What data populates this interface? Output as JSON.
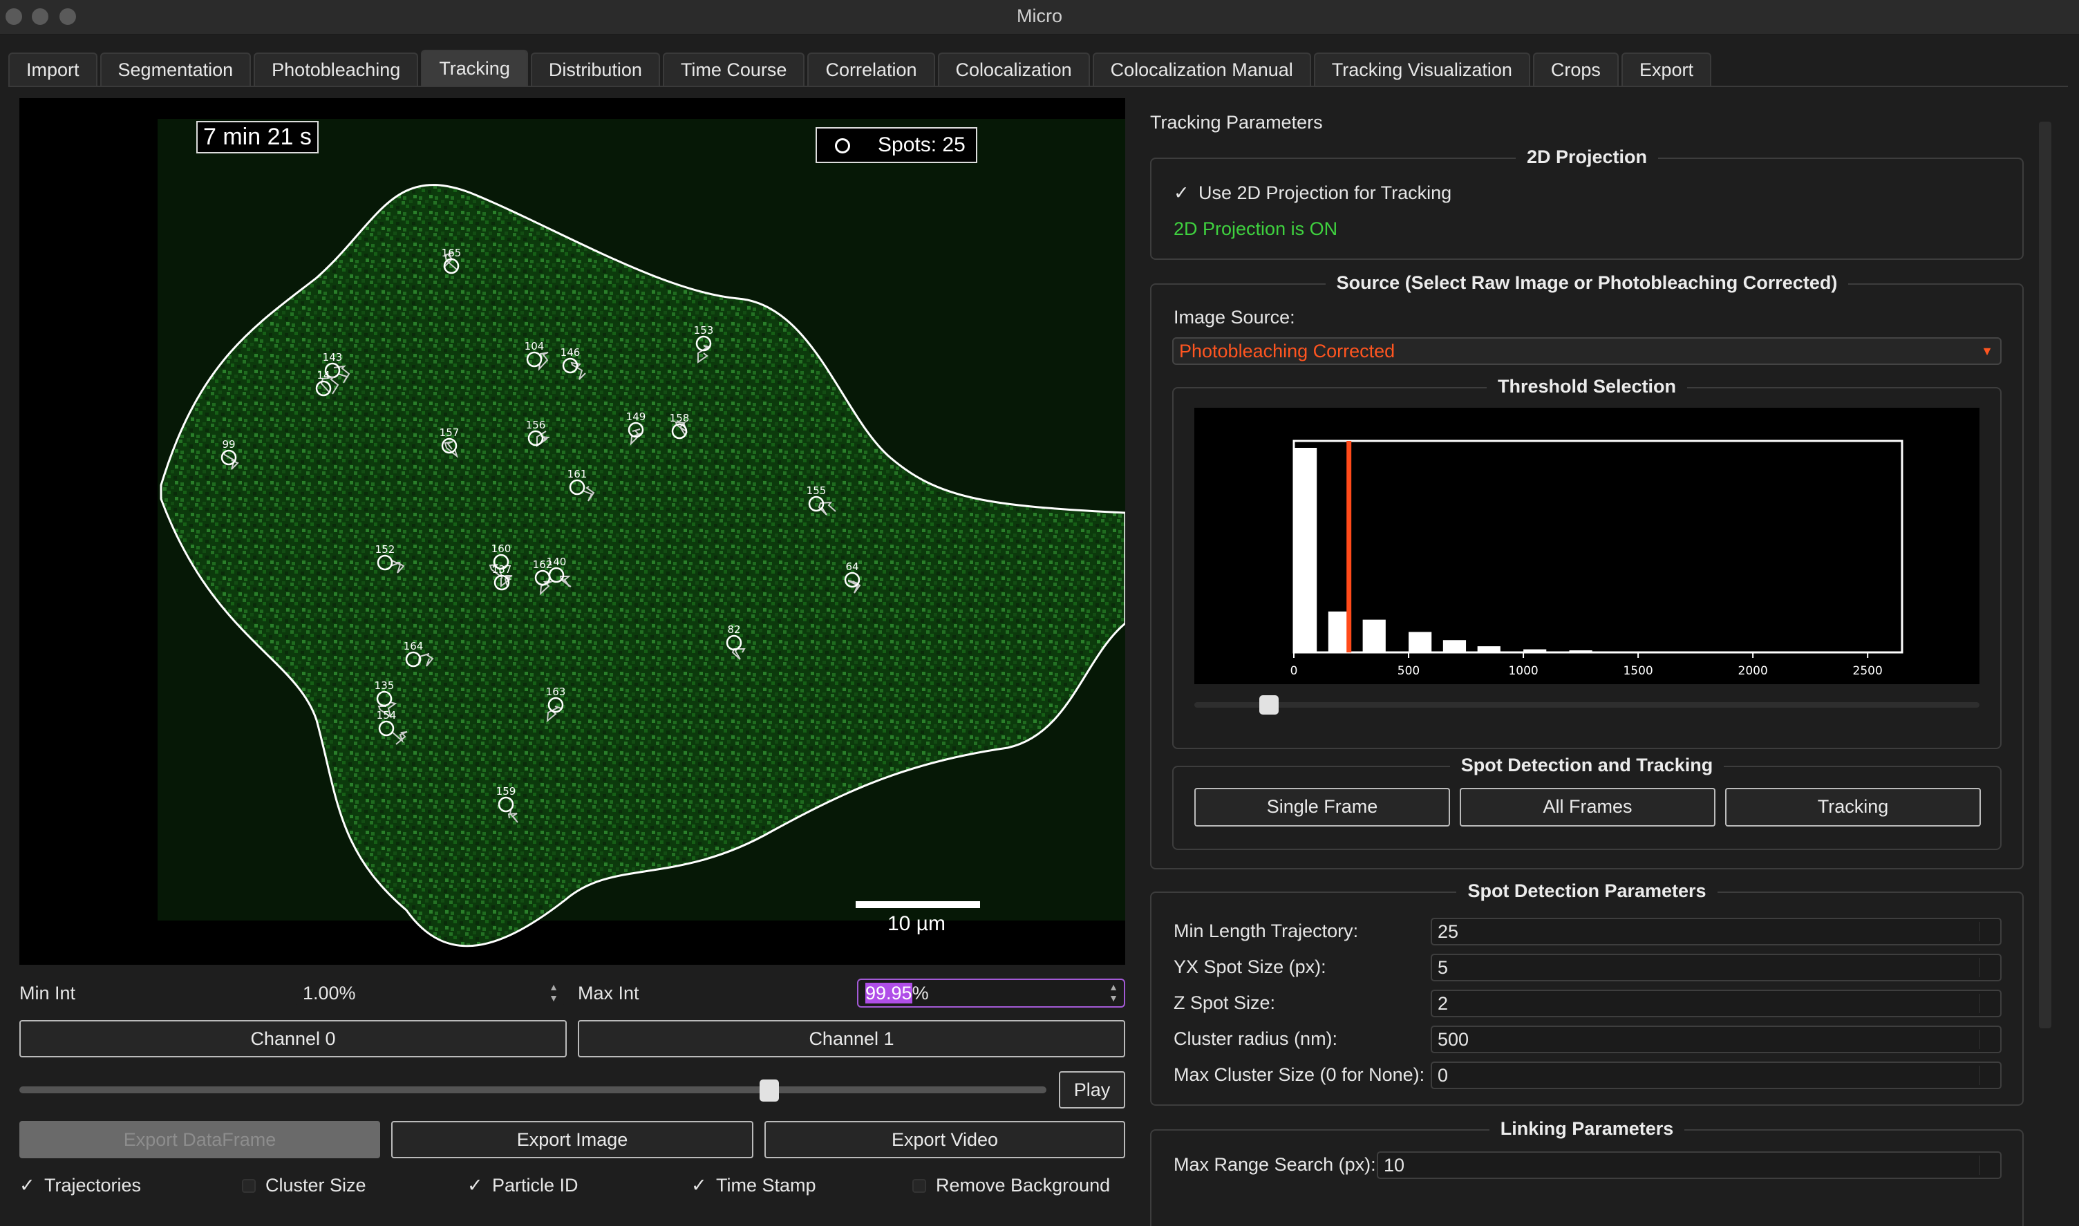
{
  "window": {
    "title": "Micro"
  },
  "tabs": [
    "Import",
    "Segmentation",
    "Photobleaching",
    "Tracking",
    "Distribution",
    "Time Course",
    "Correlation",
    "Colocalization",
    "Colocalization Manual",
    "Tracking Visualization",
    "Crops",
    "Export"
  ],
  "active_tab": "Tracking",
  "viewer": {
    "timestamp": "7 min 21 s",
    "spots_label": "Spots: 25",
    "scale_label": "10 µm",
    "spot_ids": [
      "165",
      "153",
      "104",
      "146",
      "143",
      "14",
      "99",
      "157",
      "156",
      "149",
      "158",
      "161",
      "155",
      "152",
      "160",
      "137",
      "162",
      "140",
      "64",
      "82",
      "164",
      "135",
      "154",
      "163",
      "159"
    ]
  },
  "controls": {
    "min_int_label": "Min Int",
    "min_int_value": "1.00%",
    "max_int_label": "Max Int",
    "max_int_selected": "99.95",
    "max_int_suffix": "%",
    "channel0": "Channel 0",
    "channel1": "Channel 1",
    "play": "Play",
    "frame_slider_fraction": 0.73,
    "export_dataframe": "Export DataFrame",
    "export_image": "Export Image",
    "export_video": "Export Video",
    "checks": [
      {
        "label": "Trajectories",
        "checked": true
      },
      {
        "label": "Cluster Size",
        "checked": false
      },
      {
        "label": "Particle ID",
        "checked": true
      },
      {
        "label": "Time Stamp",
        "checked": true
      },
      {
        "label": "Remove Background",
        "checked": false
      }
    ]
  },
  "right": {
    "title": "Tracking Parameters",
    "projection": {
      "group": "2D Projection",
      "checkbox": "Use 2D Projection for Tracking",
      "status": "2D Projection is ON"
    },
    "source": {
      "group": "Source (Select Raw Image or Photobleaching Corrected)",
      "label": "Image Source:",
      "value": "Photobleaching Corrected"
    },
    "threshold": {
      "group": "Threshold Selection",
      "slider_fraction": 0.095
    },
    "detection": {
      "group": "Spot Detection and Tracking",
      "single_frame": "Single Frame",
      "all_frames": "All Frames",
      "tracking": "Tracking"
    },
    "params": {
      "group": "Spot Detection Parameters",
      "rows": [
        {
          "label": "Min Length Trajectory:",
          "value": "25"
        },
        {
          "label": "YX Spot Size (px):",
          "value": "5"
        },
        {
          "label": "Z Spot Size:",
          "value": "2"
        },
        {
          "label": "Cluster radius (nm):",
          "value": "500"
        },
        {
          "label": "Max Cluster Size (0 for None):",
          "value": "0"
        }
      ]
    },
    "linking": {
      "group": "Linking Parameters",
      "rows": [
        {
          "label": "Max Range Search (px):",
          "value": "10"
        }
      ]
    }
  },
  "chart_data": {
    "type": "bar",
    "title": "",
    "xlabel": "",
    "ylabel": "",
    "xticks": [
      "0",
      "500",
      "1000",
      "1500",
      "2000",
      "2500"
    ],
    "xlim": [
      0,
      2650
    ],
    "bins": [
      {
        "x0": 0,
        "x1": 100,
        "value": 1.0
      },
      {
        "x0": 150,
        "x1": 250,
        "value": 0.2
      },
      {
        "x0": 300,
        "x1": 400,
        "value": 0.16
      },
      {
        "x0": 500,
        "x1": 600,
        "value": 0.1
      },
      {
        "x0": 650,
        "x1": 750,
        "value": 0.06
      },
      {
        "x0": 800,
        "x1": 900,
        "value": 0.03
      },
      {
        "x0": 1000,
        "x1": 1100,
        "value": 0.015
      },
      {
        "x0": 1200,
        "x1": 1300,
        "value": 0.01
      },
      {
        "x0": 1400,
        "x1": 1500,
        "value": 0.005
      }
    ],
    "threshold": 240,
    "colors": {
      "bars": "#ffffff",
      "threshold": "#ff4a1a",
      "background": "#000000"
    }
  }
}
